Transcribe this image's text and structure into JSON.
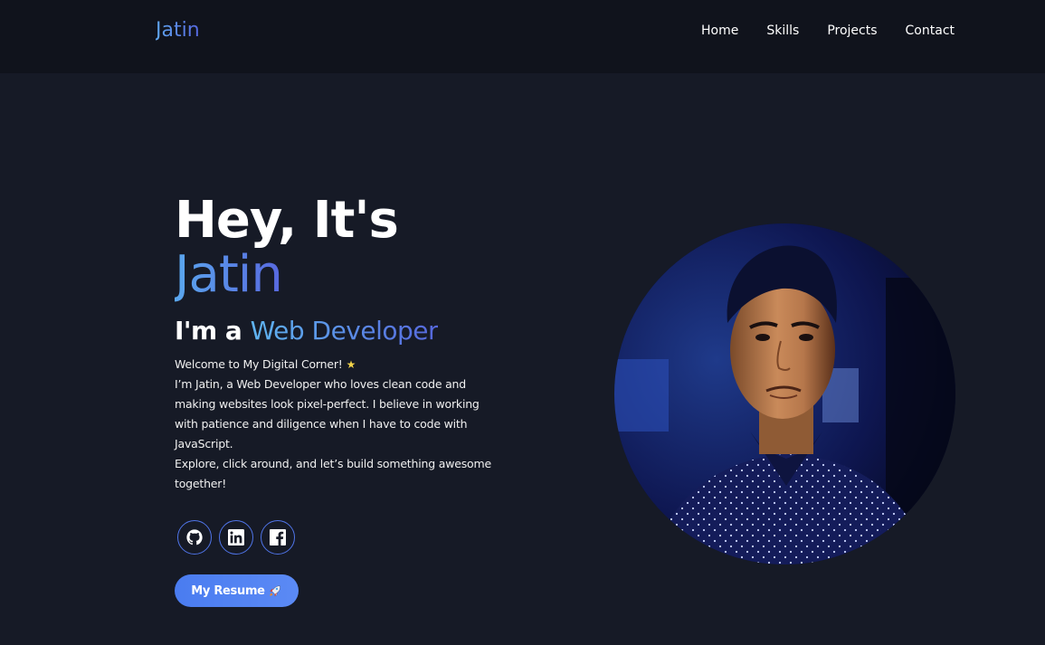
{
  "nav": {
    "logo": "Jatin",
    "links": [
      "Home",
      "Skills",
      "Projects",
      "Contact"
    ]
  },
  "hero": {
    "greeting": "Hey, It's",
    "name": "Jatin",
    "role_prefix": "I'm a ",
    "role_highlight": "Web Developer",
    "welcome": "Welcome to My Digital Corner!",
    "bio": "I’m Jatin, a Web Developer who loves clean code and making websites look pixel-perfect. I believe in working with patience and diligence when I have to code with JavaScript.",
    "cta_text": "Explore, click around, and let’s build something awesome together!",
    "resume_label": "My Resume"
  },
  "socials": [
    {
      "icon": "github-icon"
    },
    {
      "icon": "linkedin-icon"
    },
    {
      "icon": "facebook-icon"
    }
  ],
  "colors": {
    "background": "#161a26",
    "navbar": "#10131c",
    "accent_start": "#5aa7ee",
    "accent_end": "#5868df",
    "button": "#4a7cf0"
  }
}
